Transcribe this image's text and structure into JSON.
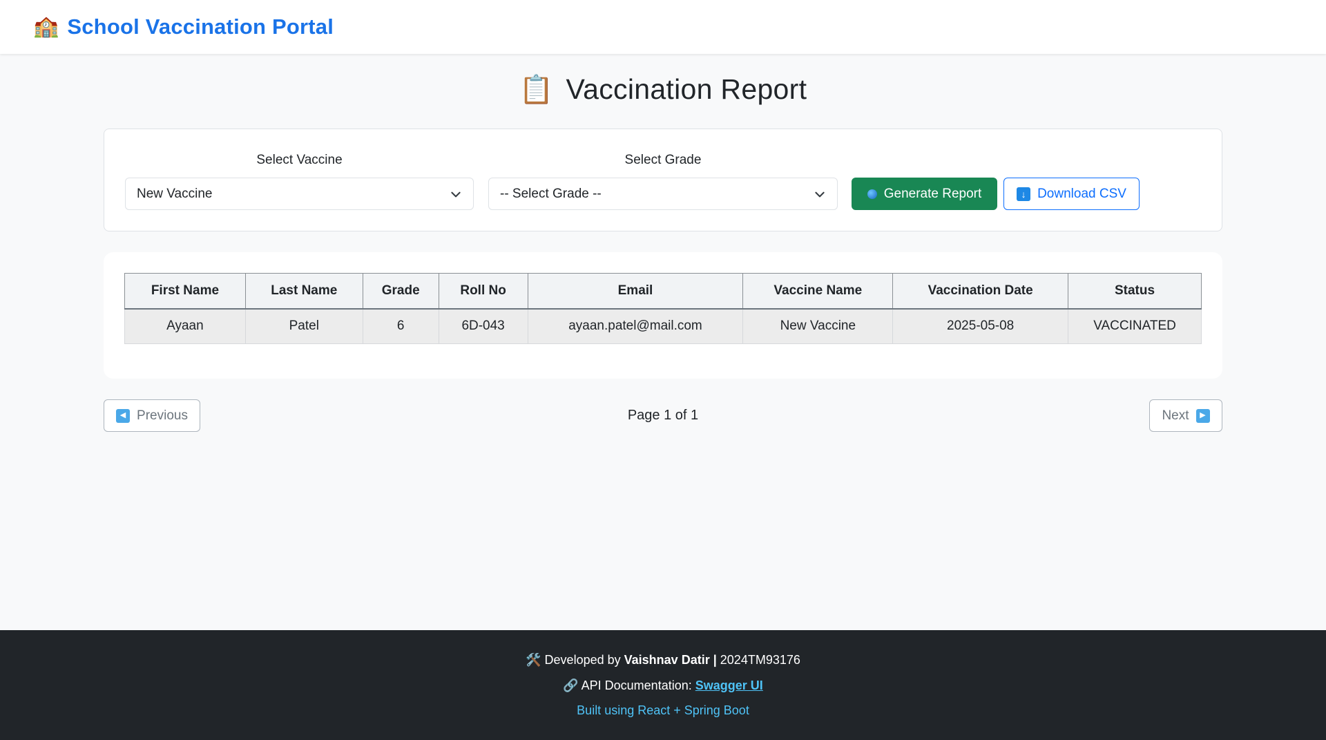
{
  "navbar": {
    "brand_icon": "🏫",
    "brand_text": "School Vaccination Portal"
  },
  "page": {
    "title_icon": "📋",
    "title": "Vaccination Report"
  },
  "filters": {
    "vaccine_label": "Select Vaccine",
    "vaccine_value": "New Vaccine",
    "grade_label": "Select Grade",
    "grade_value": "-- Select Grade --",
    "generate_label": "Generate Report",
    "download_label": "Download CSV"
  },
  "table": {
    "headers": [
      "First Name",
      "Last Name",
      "Grade",
      "Roll No",
      "Email",
      "Vaccine Name",
      "Vaccination Date",
      "Status"
    ],
    "rows": [
      [
        "Ayaan",
        "Patel",
        "6",
        "6D-043",
        "ayaan.patel@mail.com",
        "New Vaccine",
        "2025-05-08",
        "VACCINATED"
      ]
    ]
  },
  "pagination": {
    "previous_label": "Previous",
    "next_label": "Next",
    "page_text": "Page 1 of 1"
  },
  "footer": {
    "dev_icon": "🛠️",
    "dev_prefix": "Developed by",
    "dev_name": "Vaishnav Datir",
    "dev_separator": "|",
    "dev_id": "2024TM93176",
    "api_icon": "🔗",
    "api_prefix": "API Documentation:",
    "api_link": "Swagger UI",
    "built_with": "Built using React + Spring Boot"
  },
  "colors": {
    "brand": "#1a73e8",
    "success": "#198754",
    "primary": "#0d6efd",
    "footer_bg": "#212529",
    "footer_link": "#4fc3f7"
  }
}
